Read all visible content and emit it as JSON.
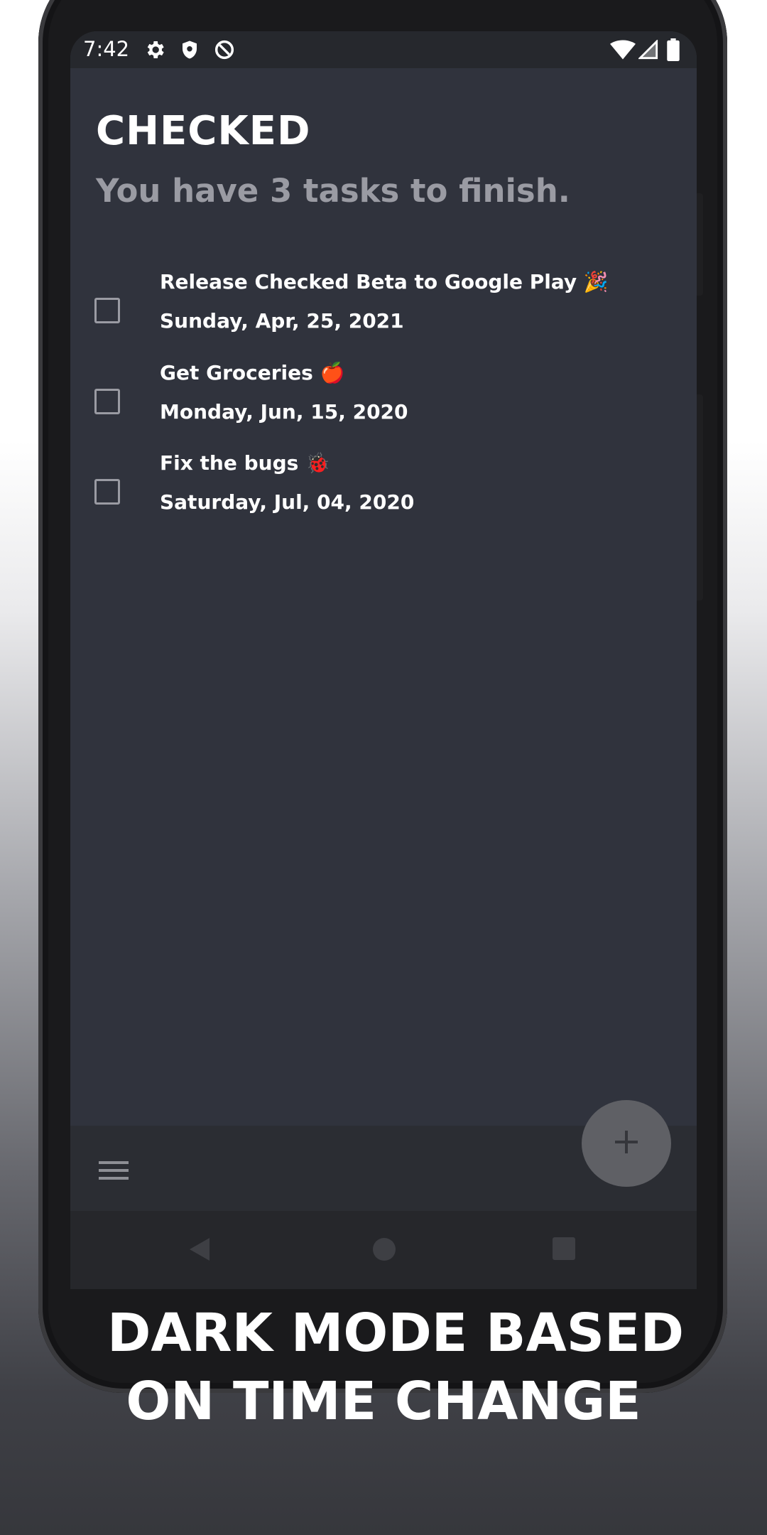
{
  "status_bar": {
    "time": "7:42",
    "left_icons": [
      "settings-icon",
      "shield-icon",
      "data-saver-icon"
    ],
    "right_icons": [
      "wifi-icon",
      "signal-icon",
      "battery-icon"
    ]
  },
  "app": {
    "title": "CHECKED",
    "subtitle": "You have 3 tasks to finish."
  },
  "tasks": [
    {
      "title": "Release Checked Beta to Google Play 🎉",
      "date": "Sunday, Apr, 25, 2021",
      "checked": false
    },
    {
      "title": "Get Groceries 🍎",
      "date": "Monday, Jun, 15, 2020",
      "checked": false
    },
    {
      "title": "Fix the bugs 🐞",
      "date": "Saturday, Jul, 04, 2020",
      "checked": false
    }
  ],
  "bottom_bar": {
    "menu_icon": "hamburger-menu-icon",
    "fab_icon": "plus-icon"
  },
  "navigation": [
    "back-icon",
    "home-icon",
    "recents-icon"
  ],
  "promo": {
    "line1": "DARK MODE BASED",
    "line2": "ON TIME CHANGE"
  },
  "colors": {
    "app_background": "#30333d",
    "bottom_bar": "#2b2d33",
    "fab": "#5f6065",
    "subtitle": "#9a9ba3",
    "text": "#ffffff"
  }
}
